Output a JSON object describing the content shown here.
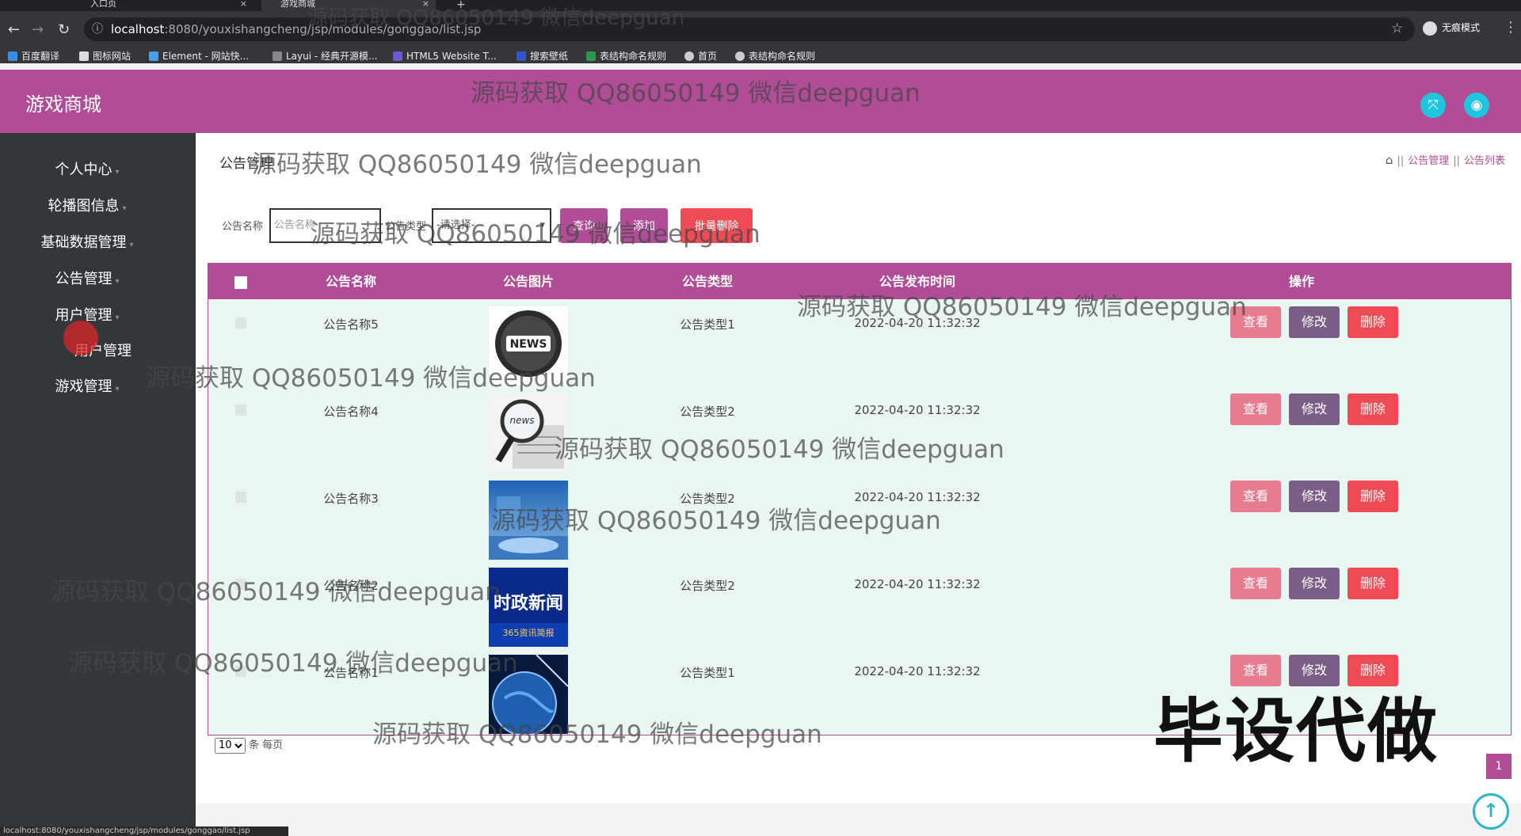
{
  "browser": {
    "tabs": [
      {
        "title": "入口页"
      },
      {
        "title": "游戏商城"
      }
    ],
    "url_host": "localhost",
    "url_path": ":8080/youxishangcheng/jsp/modules/gonggao/list.jsp",
    "incognito_label": "无痕模式",
    "bookmarks": [
      "百度翻译",
      "图标网站",
      "Element - 网站快...",
      "Layui - 经典开源模...",
      "HTML5 Website T...",
      "搜索壁纸",
      "表结构命名规则",
      "首页",
      "表结构命名规则"
    ],
    "status_url": "localhost:8080/youxishangcheng/jsp/modules/gonggao/list.jsp"
  },
  "app": {
    "title": "游戏商城"
  },
  "sidebar": {
    "items": [
      {
        "label": "个人中心"
      },
      {
        "label": "轮播图信息"
      },
      {
        "label": "基础数据管理"
      },
      {
        "label": "公告管理"
      },
      {
        "label": "用户管理"
      },
      {
        "label": "用户管理"
      },
      {
        "label": "游戏管理"
      }
    ]
  },
  "page": {
    "title": "公告管理",
    "breadcrumb": [
      "公告管理",
      "公告列表"
    ]
  },
  "search": {
    "name_label": "公告名称",
    "name_placeholder": "公告名称",
    "type_label": "公告类型",
    "type_value": "-请选择-",
    "query_label": "查询",
    "add_label": "添加",
    "batch_delete_label": "批量删除"
  },
  "table": {
    "headers": [
      "公告名称",
      "公告图片",
      "公告类型",
      "公告发布时间",
      "操作"
    ],
    "rows": [
      {
        "name": "公告名称5",
        "type": "公告类型1",
        "time": "2022-04-20 11:32:32",
        "image": "news-globe"
      },
      {
        "name": "公告名称4",
        "type": "公告类型2",
        "time": "2022-04-20 11:32:32",
        "image": "news-magnifier"
      },
      {
        "name": "公告名称3",
        "type": "公告类型2",
        "time": "2022-04-20 11:32:32",
        "image": "news-studio"
      },
      {
        "name": "公告名称2",
        "type": "公告类型2",
        "time": "2022-04-20 11:32:32",
        "image": "political-news"
      },
      {
        "name": "公告名称1",
        "type": "公告类型1",
        "time": "2022-04-20 11:32:32",
        "image": "news-earth"
      }
    ],
    "view_label": "查看",
    "edit_label": "修改",
    "delete_label": "删除"
  },
  "thumb_text": {
    "news": "NEWS",
    "news_small": "news",
    "political_title": "时政新闻",
    "political_sub": "365资讯简报"
  },
  "pagination": {
    "page_size": "10",
    "per_page_label": "条 每页",
    "current_page": "1"
  },
  "watermark": {
    "text": "源码获取 QQ86050149 微信deepguan",
    "big_text": "毕设代做"
  },
  "colors": {
    "primary": "#b04d96",
    "accent": "#1ec5dd",
    "sidebar": "#33373a",
    "view": "#e77b8f",
    "edit": "#7a5e86",
    "delete": "#ef4b55"
  }
}
